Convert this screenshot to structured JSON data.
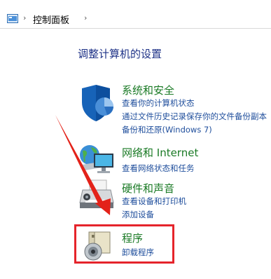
{
  "breadcrumb": {
    "sep": "›",
    "current": "控制面板",
    "trailing_sep": "›"
  },
  "heading": "调整计算机的设置",
  "categories": [
    {
      "title": "系统和安全",
      "icon": "shield-icon",
      "links": [
        "查看你的计算机状态",
        "通过文件历史记录保存你的文件备份副本",
        "备份和还原(Windows 7)"
      ]
    },
    {
      "title": "网络和 Internet",
      "icon": "network-globe-icon",
      "links": [
        "查看网络状态和任务"
      ]
    },
    {
      "title": "硬件和声音",
      "icon": "printer-icon",
      "links": [
        "查看设备和打印机",
        "添加设备"
      ]
    },
    {
      "title": "程序",
      "icon": "programs-disc-icon",
      "links": [
        "卸载程序"
      ]
    }
  ],
  "colors": {
    "category_title": "#1a7a25",
    "link": "#1f4e9c",
    "heading": "#1e3287",
    "highlight": "#e5242b"
  }
}
